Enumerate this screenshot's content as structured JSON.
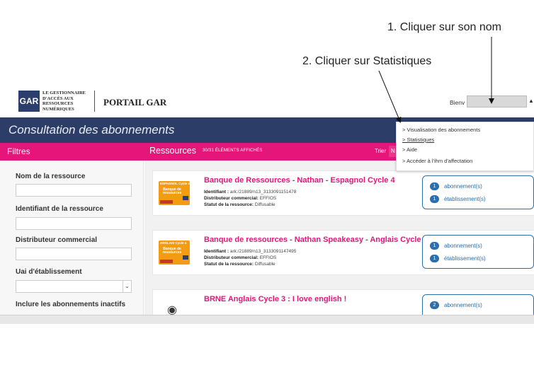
{
  "annotations": {
    "step1": "1. Cliquer sur son nom",
    "step2": "2. Cliquer sur Statistiques"
  },
  "header": {
    "logo_text": "GAR",
    "logo_lines": [
      "LE GESTIONNAIRE",
      "D'ACCÈS AUX",
      "RESSOURCES",
      "NUMÉRIQUES"
    ],
    "portal_title": "PORTAIL GAR",
    "welcome_prefix": "Bienv"
  },
  "page": {
    "title": "Consultation des abonnements"
  },
  "toolbar": {
    "filters_label": "Filtres",
    "resources_label": "Ressources",
    "count_label": "30/31 ÉLÉMENTS AFFICHÉS",
    "sort_label": "Trier",
    "sort_value": "N"
  },
  "filters": {
    "resource_name_label": "Nom de la ressource",
    "resource_id_label": "Identifiant de la ressource",
    "distributor_label": "Distributeur commercial",
    "uai_label": "Uai d'établissement",
    "include_inactive_label": "Inclure les abonnements inactifs"
  },
  "user_menu": {
    "items": [
      "> Visualisation des abonnements",
      "> Statistiques",
      "> Aide",
      "> Accéder à l'ihm d'affectation"
    ]
  },
  "labels": {
    "identifier": "Identifiant :",
    "distributor": "Distributeur commercial:",
    "status": "Statut de la ressource:",
    "subscriptions": "abonnement(s)",
    "establishments": "établissement(s)"
  },
  "resources": [
    {
      "title": "Banque de Ressources - Nathan - Espagnol Cycle 4",
      "identifier": "ark:/21889/n13_3133091151478",
      "distributor": "EFFIOS",
      "status": "Diffusable",
      "subscriptions": "1",
      "establishments": "1",
      "thumb_top": "ESPAGNOL Cycle 4",
      "thumb_main": "Banque de ressources"
    },
    {
      "title": "Banque de ressources - Nathan Speakeasy - Anglais Cycle 4",
      "identifier": "ark:/21889/n13_3133091147495",
      "distributor": "EFFIOS",
      "status": "Diffusable",
      "subscriptions": "1",
      "establishments": "1",
      "thumb_top": "ANGLAIS Cycle 4",
      "thumb_main": "Banque de ressources"
    },
    {
      "title": "BRNE Anglais Cycle 3 : I love english !",
      "subscriptions": "2"
    }
  ],
  "colors": {
    "navy": "#2c3d68",
    "pink": "#e5157a",
    "stat_blue": "#2c6fad"
  }
}
